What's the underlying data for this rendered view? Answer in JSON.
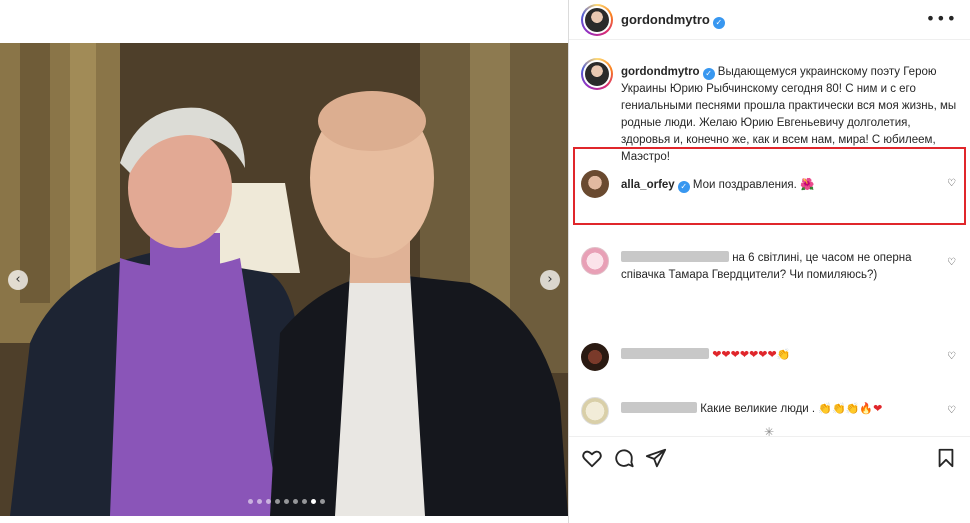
{
  "post": {
    "author": "gordondmytro",
    "caption_text": "Выдающемуся украинскому поэту Герою Украины Юрию Рыбчинскому сегодня 80! С ним и с его гениальными песнями прошла практически вся моя жизнь, мы родные люди. Желаю Юрию Евгеньевичу долголетия, здоровья и, конечно же, как и всем нам, мира! С юбилеем, Маэстро!"
  },
  "carousel": {
    "prev_icon": "chevron-left-icon",
    "next_icon": "chevron-right-icon",
    "slide_count": 9,
    "active_slide": 7
  },
  "comments": [
    {
      "username": "alla_orfey",
      "verified": true,
      "text": "Мои поздравления.",
      "emoji": "🌺"
    },
    {
      "username": "",
      "text": "на 6 світлині, це часом не оперна співачка Тамара Гвердцители? Чи помиляюсь?)"
    },
    {
      "username": "",
      "text": "",
      "emoji": "❤❤❤❤❤❤❤👏"
    },
    {
      "username": "",
      "text": "Какие великие люди .",
      "emoji": "👏👏👏🔥❤"
    }
  ],
  "actions": {
    "like_icon": "heart-icon",
    "comment_icon": "comment-icon",
    "share_icon": "send-icon",
    "save_icon": "bookmark-icon"
  },
  "colors": {
    "verified": "#3897f0",
    "highlight_border": "#e0262b",
    "text": "#262626"
  }
}
